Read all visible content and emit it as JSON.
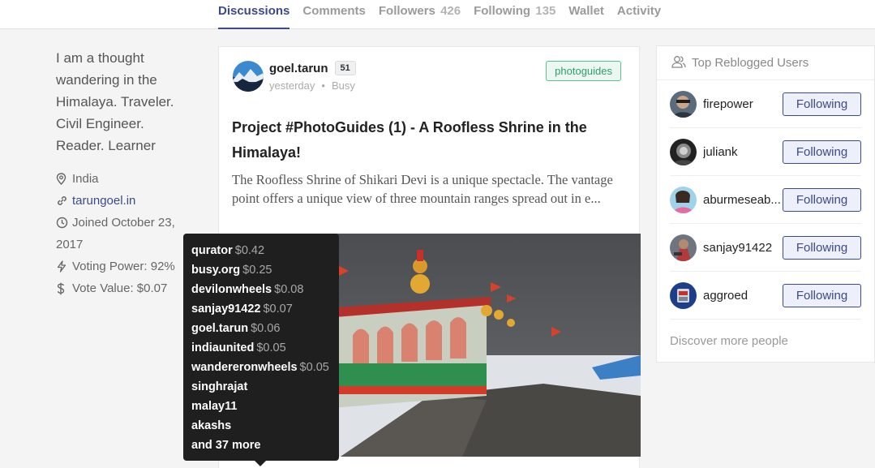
{
  "tabs": [
    {
      "label": "Discussions",
      "count": ""
    },
    {
      "label": "Comments",
      "count": ""
    },
    {
      "label": "Followers",
      "count": "426"
    },
    {
      "label": "Following",
      "count": "135"
    },
    {
      "label": "Wallet",
      "count": ""
    },
    {
      "label": "Activity",
      "count": ""
    }
  ],
  "profile": {
    "bio": "I am a thought wandering in the Himalaya. Traveler. Civil Engineer. Reader. Learner",
    "location": "India",
    "website": "tarungoel.in",
    "joined": "Joined October 23, 2017",
    "voting_power": "Voting Power: 92%",
    "vote_value": "Vote Value: $0.07"
  },
  "post": {
    "author": "goel.tarun",
    "reputation": "51",
    "time": "yesterday",
    "app": "Busy",
    "tag": "photoguides",
    "title": "Project #PhotoGuides (1) - A Roofless Shrine in the Himalaya!",
    "excerpt": "The Roofless Shrine of Shikari Devi is a unique spectacle. The vantage point offers a unique view of three mountain ranges spread out in e..."
  },
  "voters": [
    {
      "name": "qurator",
      "amount": "$0.42"
    },
    {
      "name": "busy.org",
      "amount": "$0.25"
    },
    {
      "name": "devilonwheels",
      "amount": "$0.08"
    },
    {
      "name": "sanjay91422",
      "amount": "$0.07"
    },
    {
      "name": "goel.tarun",
      "amount": "$0.06"
    },
    {
      "name": "indiaunited",
      "amount": "$0.05"
    },
    {
      "name": "wandereronwheels",
      "amount": "$0.05"
    },
    {
      "name": "singhrajat",
      "amount": ""
    },
    {
      "name": "malay11",
      "amount": ""
    },
    {
      "name": "akashs",
      "amount": ""
    },
    {
      "name": "and 37 more",
      "amount": ""
    }
  ],
  "sidebar": {
    "title": "Top Reblogged Users",
    "users": [
      {
        "name": "firepower",
        "button": "Following"
      },
      {
        "name": "juliank",
        "button": "Following"
      },
      {
        "name": "aburmeseab...",
        "button": "Following"
      },
      {
        "name": "sanjay91422",
        "button": "Following"
      },
      {
        "name": "aggroed",
        "button": "Following"
      }
    ],
    "discover": "Discover more people"
  },
  "icons": {
    "location": "map-pin-icon",
    "website": "link-icon",
    "joined": "clock-icon",
    "voting_power": "lightning-icon",
    "vote_value": "dollar-icon",
    "sidebar_header": "users-icon"
  },
  "colors": {
    "accent": "#3c4a87",
    "tag_green": "#2e9e6b",
    "tooltip_bg": "#1f1f1f"
  }
}
